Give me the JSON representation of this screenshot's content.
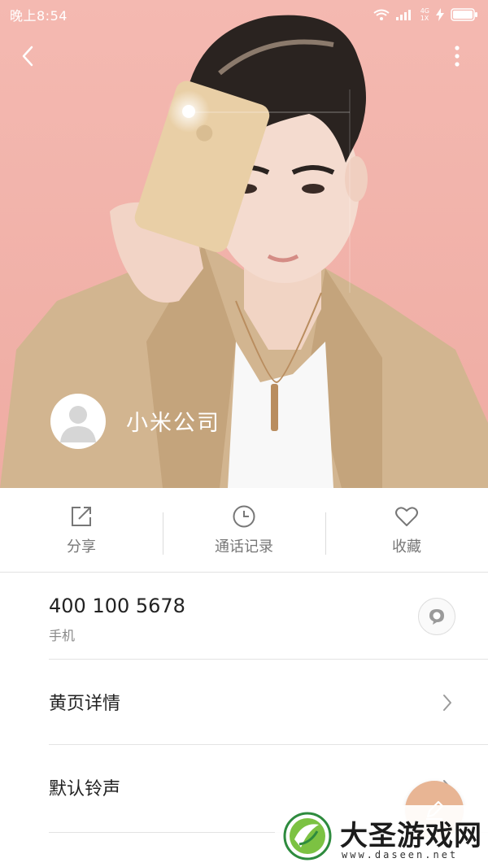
{
  "status_bar": {
    "time": "晚上8:54",
    "network_top": "4G",
    "network_bottom": "1X"
  },
  "header": {
    "back_icon": "chevron-left-icon",
    "more_icon": "more-vertical-icon",
    "contact_name": "小米公司",
    "background_color": "#f3b6ae"
  },
  "actions": [
    {
      "label": "分享",
      "icon": "share-icon"
    },
    {
      "label": "通话记录",
      "icon": "clock-icon"
    },
    {
      "label": "收藏",
      "icon": "heart-icon"
    }
  ],
  "phone": {
    "number": "400 100 5678",
    "type": "手机",
    "message_icon": "message-icon"
  },
  "rows": {
    "yellow_pages": "黄页详情",
    "ringtone": "默认铃声"
  },
  "fab": {
    "icon": "edit-icon",
    "color": "#e8b594"
  },
  "watermark": {
    "title": "大圣游戏网",
    "url": "www.daseen.net"
  }
}
